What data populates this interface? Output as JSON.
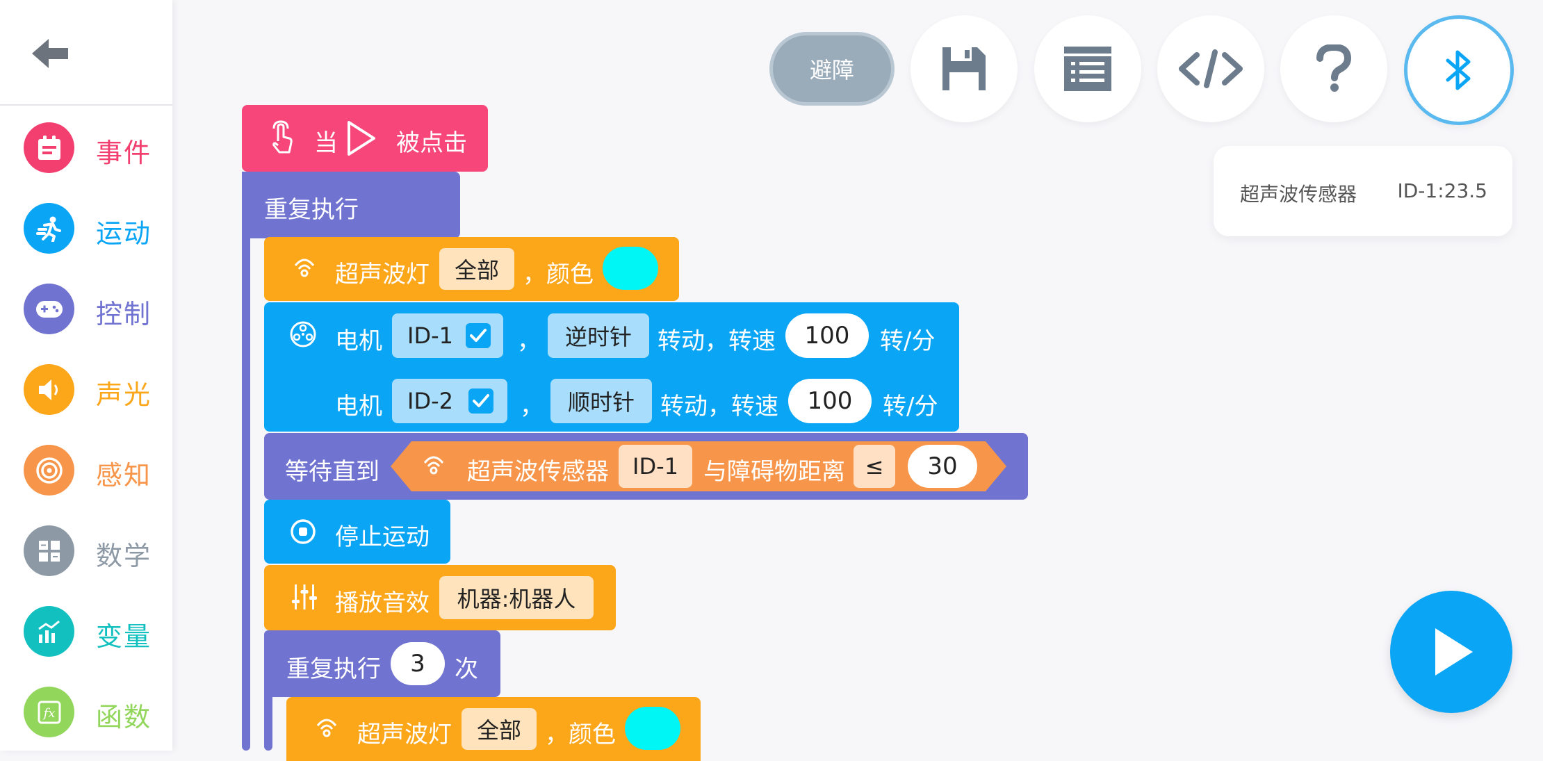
{
  "sidebar": {
    "categories": [
      {
        "label": "事件",
        "icon": "calendar-icon",
        "color": "#f23f6f"
      },
      {
        "label": "运动",
        "icon": "running-icon",
        "color": "#0aa5f5"
      },
      {
        "label": "控制",
        "icon": "gamepad-icon",
        "color": "#7173d1"
      },
      {
        "label": "声光",
        "icon": "speaker-icon",
        "color": "#fca61a"
      },
      {
        "label": "感知",
        "icon": "target-icon",
        "color": "#f7964a"
      },
      {
        "label": "数学",
        "icon": "calculator-icon",
        "color": "#8d99a5"
      },
      {
        "label": "变量",
        "icon": "chart-icon",
        "color": "#13c0c0"
      },
      {
        "label": "函数",
        "icon": "function-icon",
        "color": "#92d65b"
      }
    ]
  },
  "toolbar": {
    "mode_label": "避障"
  },
  "sensor_panel": {
    "name": "超声波传感器",
    "value": "ID-1:23.5"
  },
  "blocks": {
    "hat": {
      "when": "当",
      "clicked": "被点击"
    },
    "repeat_forever": {
      "label": "重复执行"
    },
    "light1": {
      "label": "超声波灯",
      "target": "全部",
      "color_label": "，颜色",
      "color": "#00f5f5"
    },
    "motor": {
      "label1": "电机",
      "id1": "ID-1",
      "comma1": "，",
      "dir1": "逆时针",
      "rotate1": "转动，转速",
      "speed1": "100",
      "unit1": "转/分",
      "label2": "电机",
      "id2": "ID-2",
      "comma2": "，",
      "dir2": "顺时针",
      "rotate2": "转动，转速",
      "speed2": "100",
      "unit2": "转/分"
    },
    "wait_until": {
      "label": "等待直到",
      "sensor": "超声波传感器",
      "id": "ID-1",
      "distance": "与障碍物距离",
      "op": "≤",
      "value": "30"
    },
    "stop": {
      "label": "停止运动"
    },
    "sound": {
      "label": "播放音效",
      "sound": "机器:机器人"
    },
    "repeat_n": {
      "label": "重复执行",
      "count": "3",
      "times": "次"
    },
    "light2": {
      "label": "超声波灯",
      "target": "全部",
      "color_label": "，颜色",
      "color": "#00f5f5"
    }
  }
}
